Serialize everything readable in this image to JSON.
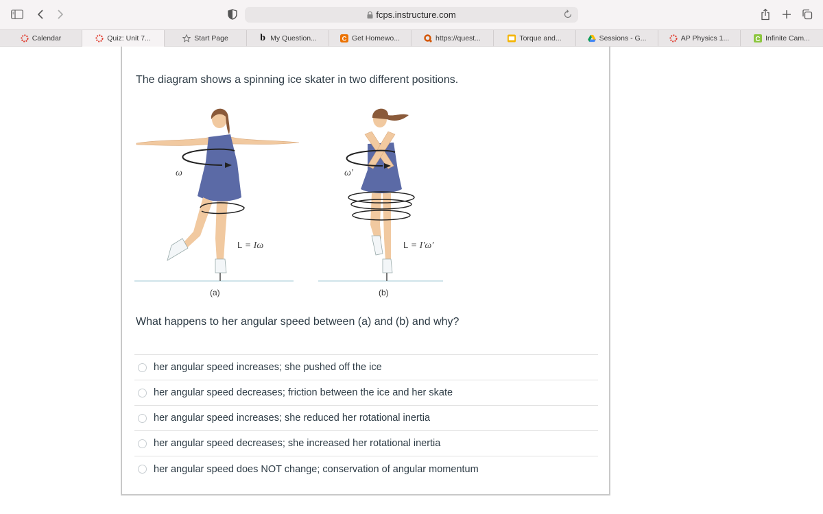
{
  "browser": {
    "url": "fcps.instructure.com",
    "icons": {
      "sidebar": "sidebar-icon",
      "back": "chevron-left-icon",
      "forward": "chevron-right-icon",
      "privacy": "shield-icon",
      "lock": "lock-icon",
      "reload": "reload-icon",
      "share": "share-icon",
      "new_tab": "plus-icon",
      "tab_overview": "tabs-overview-icon"
    }
  },
  "bookmarks": [
    {
      "label": "Calendar",
      "icon": "canvas-icon",
      "active": false
    },
    {
      "label": "Quiz: Unit 7...",
      "icon": "canvas-icon",
      "active": true
    },
    {
      "label": "Start Page",
      "icon": "star-icon",
      "active": false
    },
    {
      "label": "My Question...",
      "icon": "bartleby-icon",
      "active": false
    },
    {
      "label": "Get Homewo...",
      "icon": "chegg-icon",
      "active": false
    },
    {
      "label": "https://quest...",
      "icon": "quest-icon",
      "active": false
    },
    {
      "label": "Torque and...",
      "icon": "slides-icon",
      "active": false
    },
    {
      "label": "Sessions - G...",
      "icon": "google-drive-icon",
      "active": false
    },
    {
      "label": "AP Physics 1...",
      "icon": "canvas-icon",
      "active": false
    },
    {
      "label": "Infinite Cam...",
      "icon": "infinite-campus-icon",
      "active": false
    }
  ],
  "quiz": {
    "intro": "The diagram shows a spinning ice skater in two different positions.",
    "diagram": {
      "panel_a": {
        "label": "(a)",
        "omega": "ω",
        "equation_L": "L",
        "equation_rest": " = Iω"
      },
      "panel_b": {
        "label": "(b)",
        "omega": "ω′",
        "equation_L": "L",
        "equation_rest": " = I′ω′"
      }
    },
    "question": "What happens to her angular speed between (a) and (b) and why?",
    "answers": [
      {
        "text": "her angular speed increases; she pushed off the ice",
        "selected": false
      },
      {
        "text": "her angular speed decreases; friction between the ice and her skate",
        "selected": false
      },
      {
        "text": "her angular speed increases; she reduced her rotational inertia",
        "selected": false
      },
      {
        "text": "her angular speed decreases; she increased her rotational inertia",
        "selected": false
      },
      {
        "text": "her angular speed does NOT change; conservation of angular momentum",
        "selected": false
      }
    ]
  },
  "colors": {
    "text": "#2d3b45",
    "dress": "#5b6aa6",
    "skin": "#f1c9a0",
    "hair": "#8a5a3a",
    "ice_line": "#cfe3ea"
  }
}
